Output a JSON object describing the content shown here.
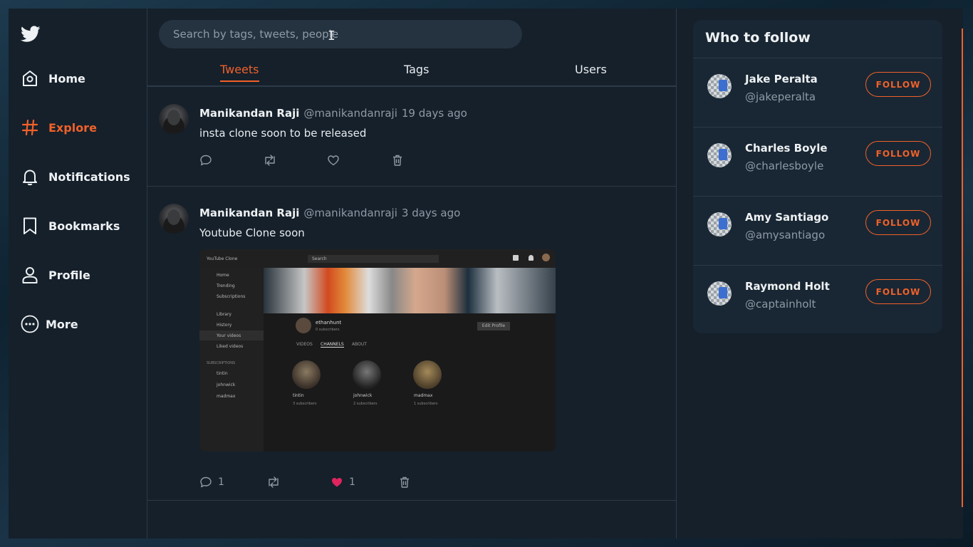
{
  "colors": {
    "accent": "#f0612a",
    "like": "#e0245e",
    "bg": "#15202b",
    "card": "#192734"
  },
  "sidebar": {
    "logo": "twitter-bird-icon",
    "items": [
      {
        "label": "Home",
        "icon": "home-icon",
        "active": false
      },
      {
        "label": "Explore",
        "icon": "hashtag-icon",
        "active": true
      },
      {
        "label": "Notifications",
        "icon": "bell-icon",
        "active": false
      },
      {
        "label": "Bookmarks",
        "icon": "bookmark-icon",
        "active": false
      },
      {
        "label": "Profile",
        "icon": "user-icon",
        "active": false
      },
      {
        "label": "More",
        "icon": "more-icon",
        "active": false
      }
    ]
  },
  "search": {
    "placeholder": "Search by tags, tweets, people",
    "value": ""
  },
  "tabs": [
    {
      "label": "Tweets",
      "active": true
    },
    {
      "label": "Tags",
      "active": false
    },
    {
      "label": "Users",
      "active": false
    }
  ],
  "tweets": [
    {
      "name": "Manikandan Raji",
      "handle": "@manikandanraji",
      "time": "19 days ago",
      "text": "insta clone soon to be released",
      "comments": "",
      "likes": "",
      "liked": false
    },
    {
      "name": "Manikandan Raji",
      "handle": "@manikandanraji",
      "time": "3 days ago",
      "text": "Youtube Clone soon",
      "comments": "1",
      "likes": "1",
      "liked": true,
      "image": {
        "app_title": "YouTube Clone",
        "search": "Search",
        "nav": [
          "Home",
          "Trending",
          "Subscriptions",
          "Library",
          "History",
          "Your videos",
          "Liked videos"
        ],
        "subs_heading": "SUBSCRIPTIONS",
        "subs": [
          "tintin",
          "johnwick",
          "madmax"
        ],
        "channel_name": "ethanhunt",
        "channel_subs": "0 subscribers",
        "edit_button": "Edit Profile",
        "channel_tabs": [
          "VIDEOS",
          "CHANNELS",
          "ABOUT"
        ],
        "channels": [
          {
            "name": "tintin",
            "subs": "3 subscribers"
          },
          {
            "name": "johnwick",
            "subs": "2 subscribers"
          },
          {
            "name": "madmax",
            "subs": "1 subscribers"
          }
        ]
      }
    }
  ],
  "who_to_follow": {
    "title": "Who to follow",
    "button_label": "FOLLOW",
    "users": [
      {
        "name": "Jake Peralta",
        "handle": "@jakeperalta"
      },
      {
        "name": "Charles Boyle",
        "handle": "@charlesboyle"
      },
      {
        "name": "Amy Santiago",
        "handle": "@amysantiago"
      },
      {
        "name": "Raymond Holt",
        "handle": "@captainholt"
      }
    ]
  }
}
